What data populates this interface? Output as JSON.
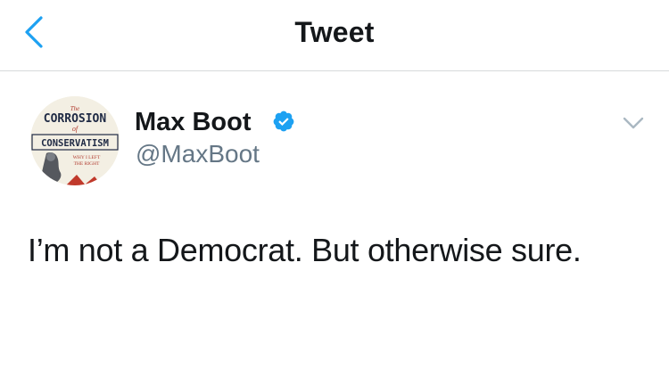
{
  "header": {
    "title": "Tweet",
    "back_icon": "chevron-left-icon",
    "accent_color": "#1da1f2"
  },
  "tweet": {
    "author": {
      "name": "Max Boot",
      "handle": "@MaxBoot",
      "verified": true,
      "verified_icon": "verified-badge-icon",
      "avatar": {
        "kind": "book-cover-thumbnail",
        "lines": [
          "The",
          "CORROSION",
          "of",
          "CONSERVATISM",
          "WHY I LEFT",
          "THE RIGHT"
        ]
      }
    },
    "menu_icon": "chevron-down-icon",
    "text": "I’m not a Democrat. But otherwise sure."
  }
}
